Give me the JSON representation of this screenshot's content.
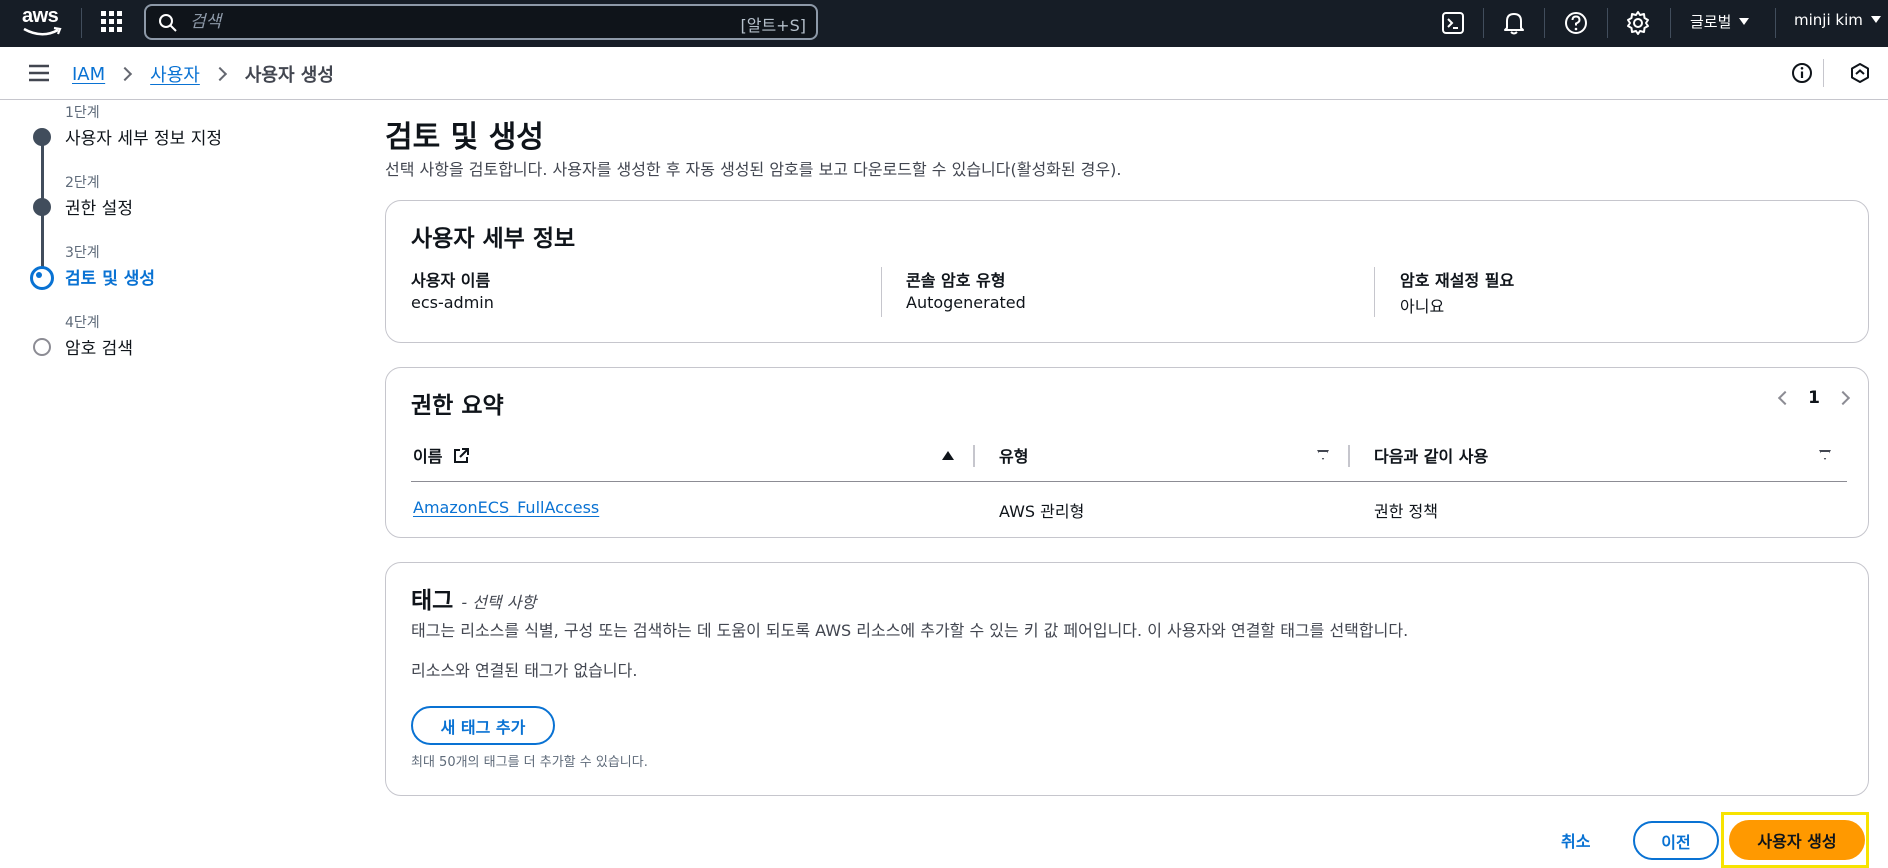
{
  "topnav": {
    "logo": "aws",
    "search_placeholder": "검색",
    "search_shortcut": "[알트+S]",
    "region": "글로벌",
    "user": "minji kim",
    "icons": [
      "grid-icon",
      "cloudshell-icon",
      "bell-icon",
      "help-icon",
      "gear-icon"
    ]
  },
  "breadcrumb": {
    "items": [
      "IAM",
      "사용자"
    ],
    "current": "사용자 생성"
  },
  "steps": [
    {
      "num": "1단계",
      "title": "사용자 세부 정보 지정",
      "state": "done"
    },
    {
      "num": "2단계",
      "title": "권한 설정",
      "state": "done"
    },
    {
      "num": "3단계",
      "title": "검토 및 생성",
      "state": "current"
    },
    {
      "num": "4단계",
      "title": "암호 검색",
      "state": "future"
    }
  ],
  "main": {
    "title": "검토 및 생성",
    "description": "선택 사항을 검토합니다. 사용자를 생성한 후 자동 생성된 암호를 보고 다운로드할 수 있습니다(활성화된 경우)."
  },
  "user_details": {
    "title": "사용자 세부 정보",
    "fields": [
      {
        "label": "사용자 이름",
        "value": "ecs-admin"
      },
      {
        "label": "콘솔 암호 유형",
        "value": "Autogenerated"
      },
      {
        "label": "암호 재설정 필요",
        "value": "아니요"
      }
    ]
  },
  "permissions": {
    "title": "권한 요약",
    "page": "1",
    "columns": [
      "이름",
      "유형",
      "다음과 같이 사용"
    ],
    "rows": [
      {
        "name": "AmazonECS_FullAccess",
        "type": "AWS 관리형",
        "used_as": "권한 정책"
      }
    ]
  },
  "tags": {
    "title": "태그",
    "optional": "- 선택 사항",
    "description": "태그는 리소스를 식별, 구성 또는 검색하는 데 도움이 되도록 AWS 리소스에 추가할 수 있는 키 값 페어입니다. 이 사용자와 연결할 태그를 선택합니다.",
    "empty": "리소스와 연결된 태그가 없습니다.",
    "add_button": "새 태그 추가",
    "hint": "최대 50개의 태그를 더 추가할 수 있습니다."
  },
  "actions": {
    "cancel": "취소",
    "previous": "이전",
    "create": "사용자 생성"
  },
  "colors": {
    "nav_bg": "#161d26",
    "link": "#0972d3",
    "primary": "#ff9900",
    "focus": "#f7e300"
  }
}
